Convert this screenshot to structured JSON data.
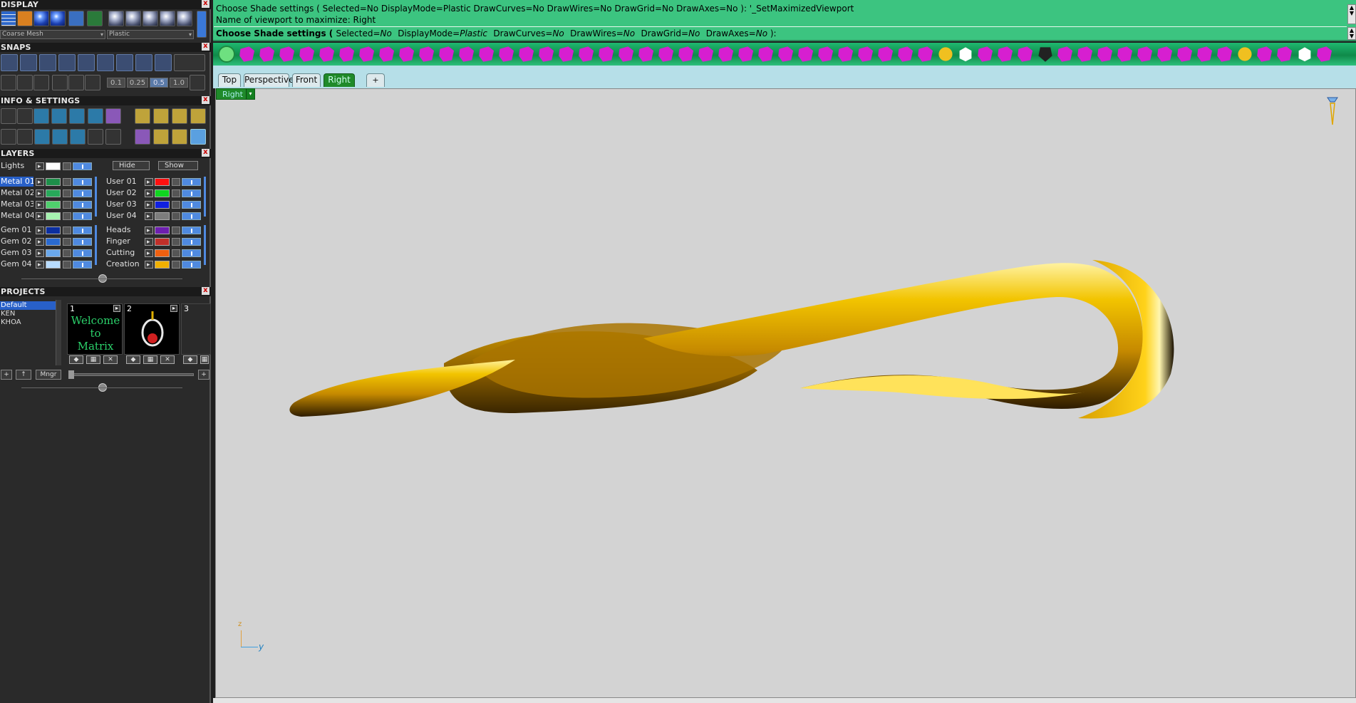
{
  "panels": {
    "display": "DISPLAY",
    "snaps": "SNAPS",
    "info": "INFO & SETTINGS",
    "layers": "LAYERS",
    "projects": "PROJECTS",
    "close": "x"
  },
  "display": {
    "mesh_select": "Coarse Mesh",
    "material_select": "Plastic"
  },
  "snaps": {
    "steps": [
      "0.1",
      "0.25",
      "0.5",
      "1.0"
    ],
    "active_step": "0.5"
  },
  "layers": {
    "lights_label": "Lights",
    "hide_label": "Hide",
    "show_label": "Show",
    "left_group_1": [
      {
        "name": "Metal 01",
        "color": "#1e8f4a",
        "selected": true
      },
      {
        "name": "Metal 02",
        "color": "#27a85a",
        "selected": false
      },
      {
        "name": "Metal 03",
        "color": "#4fcf6d",
        "selected": false
      },
      {
        "name": "Metal 04",
        "color": "#a6f2b0",
        "selected": false
      }
    ],
    "right_group_1": [
      {
        "name": "User 01",
        "color": "#ff1010"
      },
      {
        "name": "User 02",
        "color": "#10d420"
      },
      {
        "name": "User 03",
        "color": "#1020e0"
      },
      {
        "name": "User 04",
        "color": "#7d7d7d"
      }
    ],
    "left_group_2": [
      {
        "name": "Gem 01",
        "color": "#0c2fa0"
      },
      {
        "name": "Gem 02",
        "color": "#2a6ad0"
      },
      {
        "name": "Gem 03",
        "color": "#6aa8ec"
      },
      {
        "name": "Gem 04",
        "color": "#b8dcff"
      }
    ],
    "right_group_2": [
      {
        "name": "Heads",
        "color": "#6e1fb0"
      },
      {
        "name": "Finger",
        "color": "#c0302a"
      },
      {
        "name": "Cutting",
        "color": "#f06010"
      },
      {
        "name": "Creation",
        "color": "#f0b000"
      }
    ]
  },
  "projects": {
    "list": [
      "Default",
      "KEN",
      "KHOA"
    ],
    "thumbs": [
      {
        "num": "1",
        "caption": "Welcome to Matrix"
      },
      {
        "num": "2",
        "caption": ""
      },
      {
        "num": "3",
        "caption": ""
      }
    ],
    "mngr_label": "Mngr",
    "add": "+",
    "up": "↑"
  },
  "command": {
    "line1": "Choose Shade settings ( Selected=No  DisplayMode=Plastic  DrawCurves=No  DrawWires=No  DrawGrid=No  DrawAxes=No ): '_SetMaximizedViewport",
    "line2": "Name of viewport to maximize: Right",
    "prompt_bold": "Choose Shade settings ( ",
    "p_sel_k": "Selected=",
    "p_sel_v": "No",
    "p_dm_k": "DisplayMode=",
    "p_dm_v": "Plastic",
    "p_dc_k": "DrawCurves=",
    "p_dc_v": "No",
    "p_dw_k": "DrawWires=",
    "p_dw_v": "No",
    "p_dg_k": "DrawGrid=",
    "p_dg_v": "No",
    "p_da_k": "DrawAxes=",
    "p_da_v": "No",
    "prompt_end": " ):"
  },
  "tabs": [
    "Top",
    "Perspective",
    "Front",
    "Right",
    "+"
  ],
  "active_tab": "Right",
  "viewport": {
    "label": "Right",
    "axis_z": "z",
    "axis_y": "y"
  },
  "colors": {
    "cmd_bg": "#3cc480",
    "toolbar": "#12a05c",
    "gold": "#e0a600",
    "viewport_bg": "#d3d3d3"
  }
}
